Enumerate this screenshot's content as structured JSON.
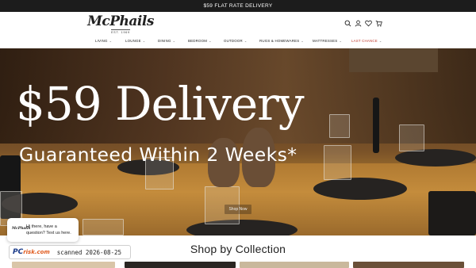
{
  "announcement": "$59 FLAT RATE DELIVERY",
  "header": {
    "logo_text": "McPhails",
    "logo_est": "EST. 1969",
    "icons": [
      "search-icon",
      "account-icon",
      "wishlist-icon",
      "cart-icon"
    ]
  },
  "nav": {
    "items": [
      {
        "label": "LIVING"
      },
      {
        "label": "LOUNGE"
      },
      {
        "label": "DINING"
      },
      {
        "label": "BEDROOM"
      },
      {
        "label": "OUTDOOR"
      },
      {
        "label": "RUGS & HOMEWARES"
      },
      {
        "label": "MATTRESSES"
      },
      {
        "label": "LAST CHANCE"
      }
    ],
    "sale_color": "#c0392b"
  },
  "hero": {
    "title": "$59 Delivery",
    "subtitle": "Guaranteed Within 2 Weeks*",
    "button_label": "Shop Now"
  },
  "collection": {
    "title": "Shop by Collection"
  },
  "chat": {
    "avatar_text": "McPhails",
    "message": "Hi there, have a question? Text us here."
  },
  "watermark": {
    "logo_pc": "PC",
    "logo_risk": "risk.com",
    "stamp": "scanned 2026-08-25"
  },
  "colors": {
    "announcement_bg": "#1c1c1c",
    "accent_sale": "#c0392b"
  }
}
